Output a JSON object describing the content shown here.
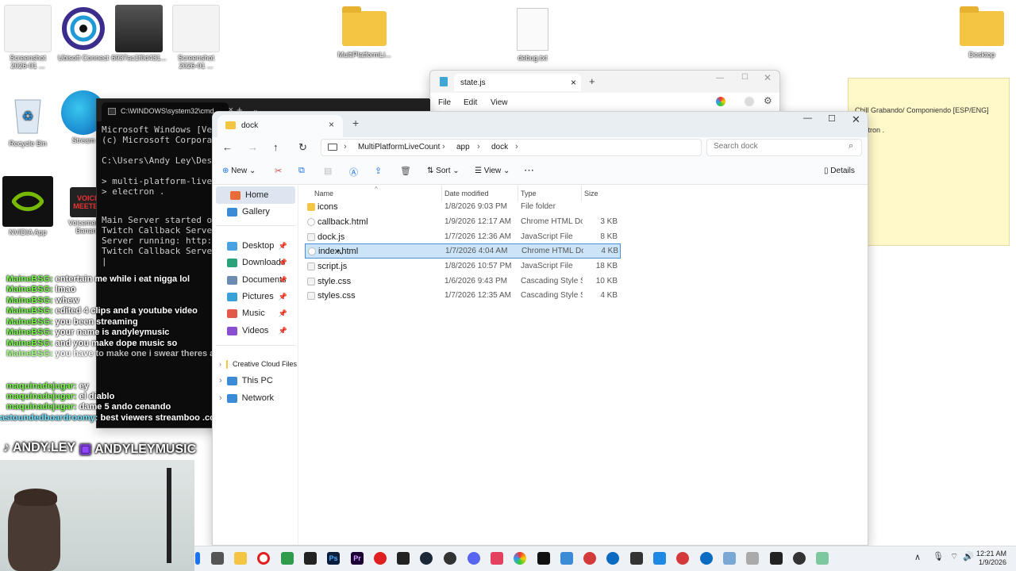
{
  "desktop": {
    "icons": [
      {
        "label": "Screenshot 2026-01 ...",
        "kind": "screenshot"
      },
      {
        "label": "Ubisoft Connect",
        "kind": "ubisoft"
      },
      {
        "label": "6937ac1f0d431...",
        "kind": "photo"
      },
      {
        "label": "Screenshot 2026-01 ...",
        "kind": "screenshot"
      },
      {
        "label": "MultiPlatformLi...",
        "kind": "folder"
      },
      {
        "label": "debug.txt",
        "kind": "doc"
      },
      {
        "label": "Desktop",
        "kind": "folder"
      },
      {
        "label": "Recycle Bin",
        "kind": "recycle"
      },
      {
        "label": "Stream",
        "kind": "edge"
      },
      {
        "label": "NVIDIA App",
        "kind": "nvidia"
      },
      {
        "label": "Voicemeeter Banana",
        "kind": "voicemeeter"
      }
    ],
    "voicemeeter_tile": "VOICE MEETER",
    "overlay_handles": [
      "ANDY.LEY",
      "ANDYLEYMUSIC"
    ]
  },
  "sticky_note": {
    "line1": "Chill Grabando/ Componiendo [ESP/ENG]",
    "line2": "electron ."
  },
  "notepad": {
    "tab_title": "state.js",
    "menu": [
      "File",
      "Edit",
      "View"
    ]
  },
  "cmd": {
    "tab_title": "C:\\WINDOWS\\system32\\cmd.",
    "lines": [
      "Microsoft Windows [Versi",
      "(c) Microsoft Corporatio",
      "",
      "C:\\Users\\Andy Ley\\Deskt",
      "",
      "> multi-platform-live-co",
      "> electron .",
      "",
      "Main Server started on p",
      "Twitch Callback Server s",
      "Server running: http://1",
      "Twitch Callback Server (",
      "|"
    ]
  },
  "chat": [
    {
      "user": "MaineBSG:",
      "msg": "entertain me while i eat nigga lol"
    },
    {
      "user": "MaineBSG:",
      "msg": "lmao"
    },
    {
      "user": "MaineBSG:",
      "msg": "whew"
    },
    {
      "user": "MaineBSG:",
      "msg": "edited 4 clips and a youtube video"
    },
    {
      "user": "MaineBSG:",
      "msg": "you been streaming"
    },
    {
      "user": "MaineBSG:",
      "msg": "your name is andyleymusic"
    },
    {
      "user": "MaineBSG:",
      "msg": "and you make dope music so"
    },
    {
      "user": "MaineBSG:",
      "msg": "you have to make one i swear theres already one out there"
    },
    {
      "user": "MaineBSG:",
      "msg": "..."
    },
    {
      "user": "MaineBSG:",
      "msg": "..."
    },
    {
      "user": "maquinadejugar:",
      "msg": "ey"
    },
    {
      "user": "maquinadejugar:",
      "msg": "el diablo"
    },
    {
      "user": "maquinadejugar:",
      "msg": "dame 5 ando cenando"
    },
    {
      "user": "astoundedboardroomy:",
      "msg": "best viewers streamboo .com (remove the space)"
    }
  ],
  "explorer": {
    "tab_title": "dock",
    "breadcrumb": [
      "MultiPlatformLiveCount",
      "app",
      "dock"
    ],
    "search_placeholder": "Search dock",
    "toolbar": {
      "new": "New",
      "sort": "Sort",
      "view": "View",
      "details": "Details"
    },
    "sidebar": {
      "home": "Home",
      "gallery": "Gallery",
      "pinned": [
        "Desktop",
        "Downloads",
        "Documents",
        "Pictures",
        "Music",
        "Videos"
      ],
      "tree": [
        "Creative Cloud Files",
        "This PC",
        "Network"
      ]
    },
    "columns": [
      "Name",
      "Date modified",
      "Type",
      "Size"
    ],
    "files": [
      {
        "name": "icons",
        "date": "1/8/2026 9:03 PM",
        "type": "File folder",
        "size": "",
        "kind": "folder"
      },
      {
        "name": "callback.html",
        "date": "1/9/2026 12:17 AM",
        "type": "Chrome HTML Do...",
        "size": "3 KB",
        "kind": "html"
      },
      {
        "name": "dock.js",
        "date": "1/7/2026 12:36 AM",
        "type": "JavaScript File",
        "size": "8 KB",
        "kind": "js"
      },
      {
        "name": "index.html",
        "date": "1/7/2026 4:04 AM",
        "type": "Chrome HTML Do...",
        "size": "4 KB",
        "kind": "html",
        "selected": true
      },
      {
        "name": "script.js",
        "date": "1/8/2026 10:57 PM",
        "type": "JavaScript File",
        "size": "18 KB",
        "kind": "js"
      },
      {
        "name": "style.css",
        "date": "1/6/2026 9:43 PM",
        "type": "Cascading Style S...",
        "size": "10 KB",
        "kind": "css"
      },
      {
        "name": "styles.css",
        "date": "1/7/2026 12:35 AM",
        "type": "Cascading Style S...",
        "size": "4 KB",
        "kind": "css"
      }
    ]
  },
  "taskbar": {
    "time": "12:21 AM",
    "date": "1/9/2026"
  }
}
